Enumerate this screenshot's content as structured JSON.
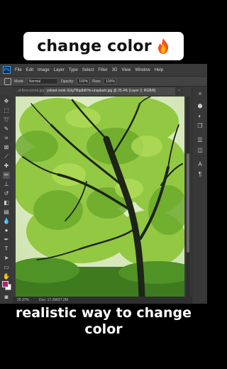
{
  "overlay": {
    "title": "change color",
    "emoji_icon": "fire-icon",
    "caption_line1": "realistic way to change",
    "caption_line2": "color"
  },
  "photoshop": {
    "logo": "Ps",
    "menu": [
      "File",
      "Edit",
      "Image",
      "Layer",
      "Type",
      "Select",
      "Filter",
      "3D",
      "View",
      "Window",
      "Help"
    ],
    "options": {
      "mode_label": "Mode:",
      "mode_value": "Normal",
      "opacity_label": "Opacity:",
      "opacity_value": "100%",
      "flow_label": "Flow:",
      "flow_value": "100%"
    },
    "tabs": [
      "...d-fbrocomnd.jpg",
      "yokset-zook-SUgTBqdbKHo-unsplash.jpg @ 25.4% (Layer 2, RGB/8)",
      "×",
      "»"
    ],
    "status": {
      "zoom": "25.37%",
      "doc": "Doc: 17.2M/37.2M"
    },
    "colors": {
      "foreground": "#b3226c",
      "background": "#ffffff",
      "accent": "#31a8ff"
    }
  }
}
